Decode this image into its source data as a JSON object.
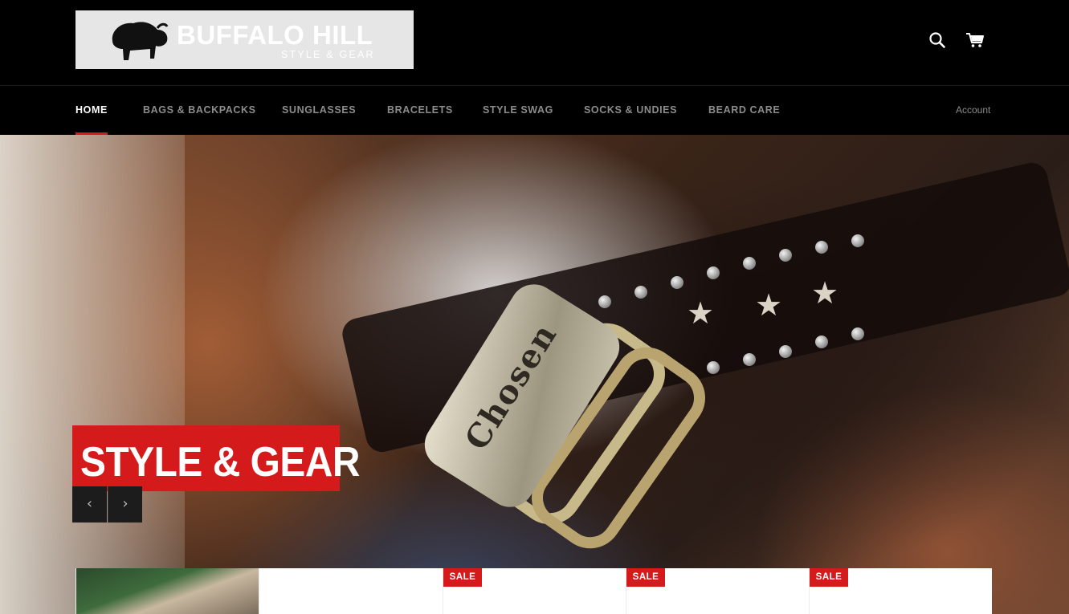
{
  "header": {
    "logo": {
      "title": "BUFFALO HILL",
      "subtitle": "STYLE & GEAR"
    },
    "icons": {
      "search": "search-icon",
      "cart": "cart-icon"
    }
  },
  "nav": {
    "items": [
      {
        "label": "HOME",
        "active": true
      },
      {
        "label": "BAGS & BACKPACKS",
        "active": false
      },
      {
        "label": "SUNGLASSES",
        "active": false
      },
      {
        "label": "BRACELETS",
        "active": false
      },
      {
        "label": "STYLE SWAG",
        "active": false
      },
      {
        "label": "SOCKS & UNDIES",
        "active": false
      },
      {
        "label": "BEARD CARE",
        "active": false
      }
    ],
    "account_label": "Account"
  },
  "hero": {
    "title": "STYLE & GEAR",
    "cuff_text": "Chosen",
    "prev_symbol": "‹",
    "next_symbol": "›"
  },
  "products": {
    "cards": [
      {
        "sale": ""
      },
      {
        "sale": ""
      },
      {
        "sale": "SALE"
      },
      {
        "sale": "SALE"
      },
      {
        "sale": "SALE"
      }
    ]
  },
  "colors": {
    "accent": "#d41a1a",
    "background": "#000000",
    "nav_text": "#8c8c8c",
    "nav_active": "#ffffff"
  }
}
